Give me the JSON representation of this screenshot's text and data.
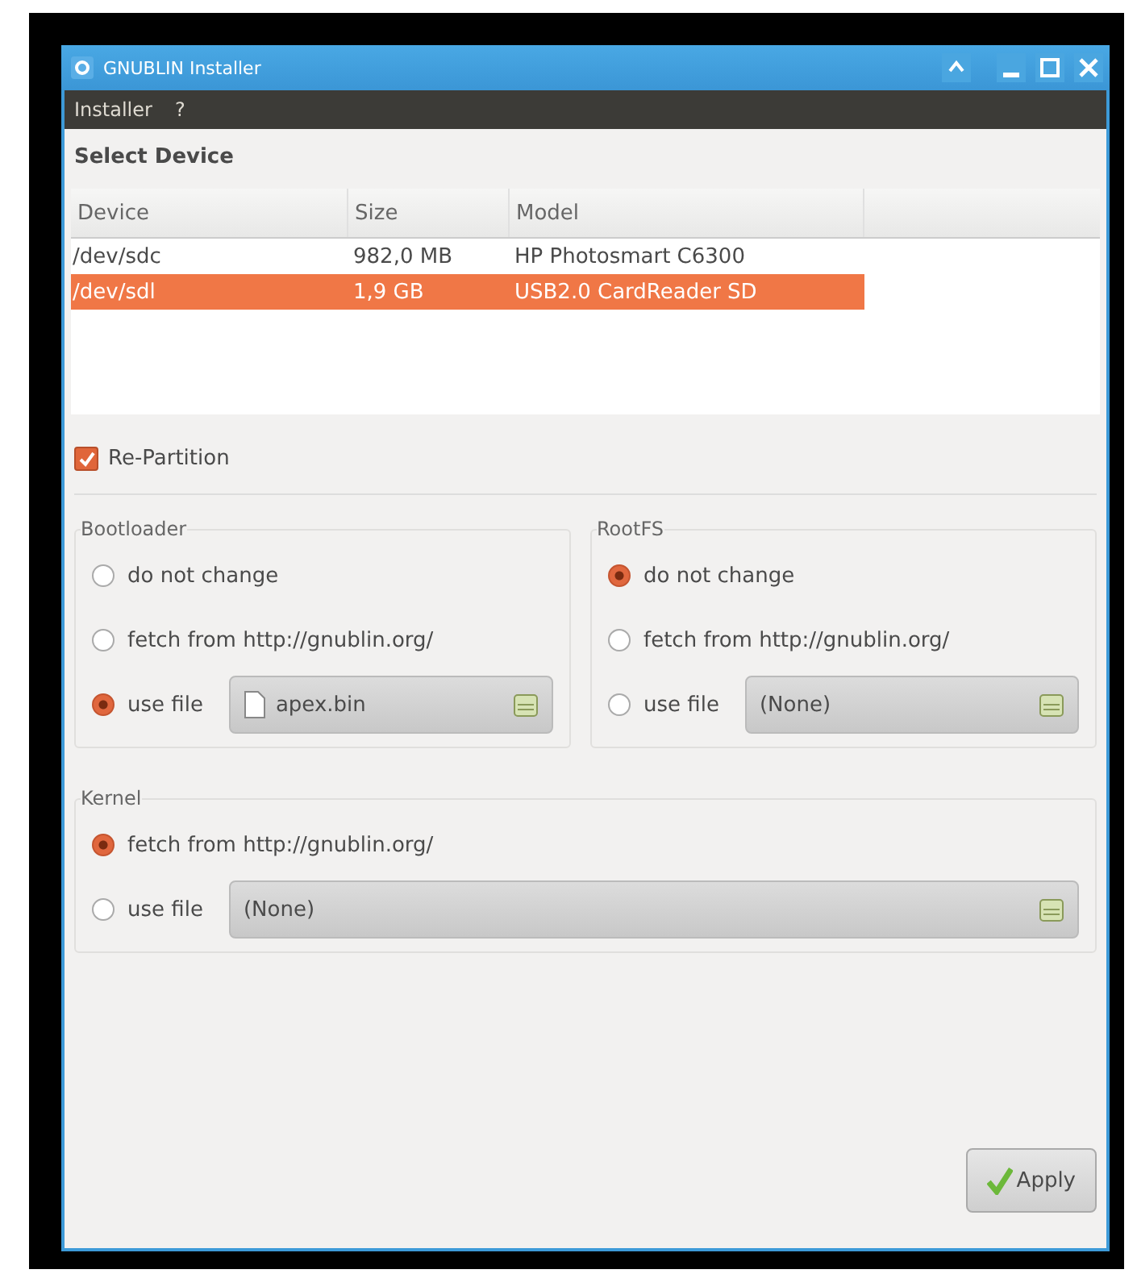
{
  "window": {
    "title": "GNUBLIN Installer"
  },
  "menu": [
    "Installer",
    "?"
  ],
  "section_title": "Select Device",
  "table": {
    "columns": [
      "Device",
      "Size",
      "Model"
    ],
    "rows": [
      {
        "cells": [
          "/dev/sdc",
          "982,0 MB",
          "HP Photosmart C6300"
        ],
        "selected": false
      },
      {
        "cells": [
          "/dev/sdl",
          "1,9 GB",
          "USB2.0 CardReader SD"
        ],
        "selected": true
      }
    ]
  },
  "repartition": {
    "label": "Re-Partition",
    "checked": true
  },
  "groups": [
    {
      "title": "Bootloader",
      "options": [
        {
          "label": "do not change",
          "selected": false
        },
        {
          "label": "fetch from http://gnublin.org/",
          "selected": false
        },
        {
          "label": "use file",
          "selected": true,
          "file": {
            "value": "apex.bin",
            "kind": "document"
          }
        }
      ]
    },
    {
      "title": "RootFS",
      "options": [
        {
          "label": "do not change",
          "selected": true
        },
        {
          "label": "fetch from http://gnublin.org/",
          "selected": false
        },
        {
          "label": "use file",
          "selected": false,
          "file": {
            "value": "(None)",
            "kind": "plain"
          }
        }
      ]
    },
    {
      "title": "Kernel",
      "options": [
        {
          "label": "fetch from http://gnublin.org/",
          "selected": true
        },
        {
          "label": "use file",
          "selected": false,
          "file": {
            "value": "(None)",
            "kind": "plain"
          }
        }
      ]
    }
  ],
  "apply_button": "Apply"
}
